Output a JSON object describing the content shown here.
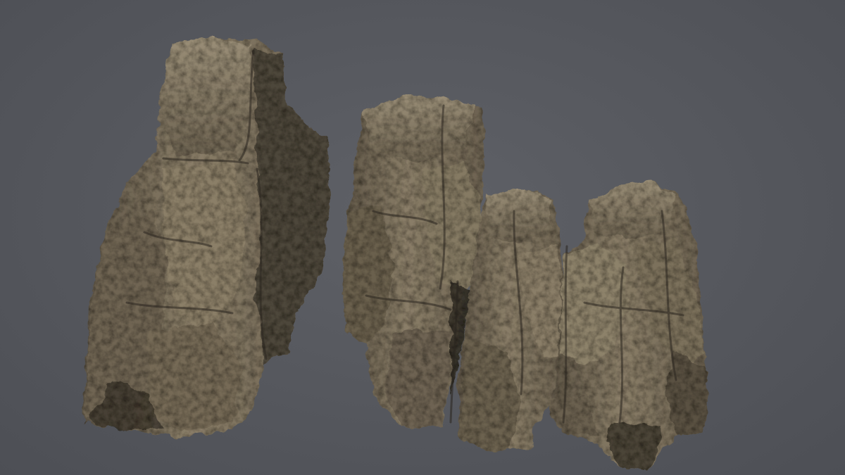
{
  "scene": {
    "subject": "rock-cliff-formations",
    "background_color": "#57595f",
    "rock_base_color": "#7a6f5d",
    "rock_highlight_color": "#a89c84",
    "rock_shadow_color": "#2f2a24",
    "moss_tint_color": "#6f6a4a",
    "formation_names": [
      "left-rock-pillar",
      "middle-tall-pillar",
      "middle-short-pillar",
      "right-rock-cluster"
    ]
  }
}
